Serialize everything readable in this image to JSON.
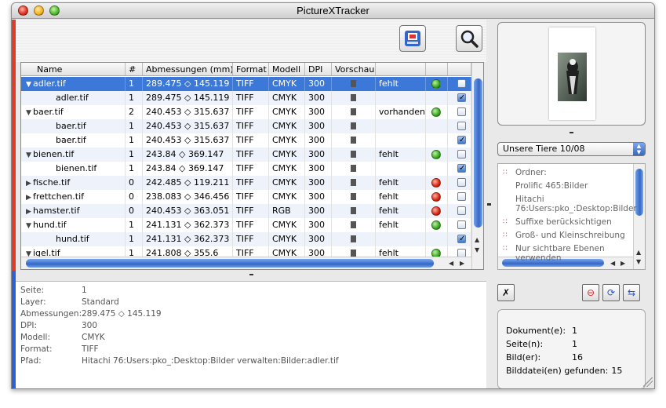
{
  "window": {
    "title": "PictureXTracker"
  },
  "accent": "#3b78d8",
  "table": {
    "headers": [
      "Name",
      "#",
      "Abmessungen (mm)",
      "Format",
      "Modell",
      "DPI",
      "Vorschau",
      "",
      "",
      ""
    ],
    "rows": [
      {
        "name": "adler.tif",
        "indent": 0,
        "tri": "▼",
        "count": "1",
        "dims": "289.475 ◇ 145.119",
        "format": "TIFF",
        "model": "CMYK",
        "dpi": "300",
        "status": "fehlt",
        "dot": "green",
        "check": false,
        "selected": true
      },
      {
        "name": "adler.tif",
        "indent": 1,
        "tri": "",
        "count": "1",
        "dims": "289.475 ◇ 145.119",
        "format": "TIFF",
        "model": "CMYK",
        "dpi": "300",
        "status": "",
        "dot": "",
        "check": true
      },
      {
        "name": "baer.tif",
        "indent": 0,
        "tri": "▼",
        "count": "2",
        "dims": "240.453 ◇ 315.637",
        "format": "TIFF",
        "model": "CMYK",
        "dpi": "300",
        "status": "vorhanden",
        "dot": "green",
        "check": false
      },
      {
        "name": "baer.tif",
        "indent": 1,
        "tri": "",
        "count": "1",
        "dims": "240.453 ◇ 315.637",
        "format": "TIFF",
        "model": "CMYK",
        "dpi": "300",
        "status": "",
        "dot": "",
        "check": false
      },
      {
        "name": "baer.tif",
        "indent": 1,
        "tri": "",
        "count": "1",
        "dims": "240.453 ◇ 315.637",
        "format": "TIFF",
        "model": "CMYK",
        "dpi": "300",
        "status": "",
        "dot": "",
        "check": true
      },
      {
        "name": "bienen.tif",
        "indent": 0,
        "tri": "▼",
        "count": "1",
        "dims": "243.84 ◇ 369.147",
        "format": "TIFF",
        "model": "CMYK",
        "dpi": "300",
        "status": "fehlt",
        "dot": "green",
        "check": false
      },
      {
        "name": "bienen.tif",
        "indent": 1,
        "tri": "",
        "count": "1",
        "dims": "243.84 ◇ 369.147",
        "format": "TIFF",
        "model": "CMYK",
        "dpi": "300",
        "status": "",
        "dot": "",
        "check": true
      },
      {
        "name": "fische.tif",
        "indent": 0,
        "tri": "▶",
        "count": "0",
        "dims": "242.485 ◇ 119.211",
        "format": "TIFF",
        "model": "CMYK",
        "dpi": "300",
        "status": "fehlt",
        "dot": "red",
        "check": false
      },
      {
        "name": "frettchen.tif",
        "indent": 0,
        "tri": "▶",
        "count": "0",
        "dims": "238.083 ◇ 346.456",
        "format": "TIFF",
        "model": "CMYK",
        "dpi": "300",
        "status": "fehlt",
        "dot": "red",
        "check": false
      },
      {
        "name": "hamster.tif",
        "indent": 0,
        "tri": "▶",
        "count": "0",
        "dims": "240.453 ◇ 363.051",
        "format": "TIFF",
        "model": "RGB",
        "dpi": "300",
        "status": "fehlt",
        "dot": "red",
        "check": false
      },
      {
        "name": "hund.tif",
        "indent": 0,
        "tri": "▼",
        "count": "1",
        "dims": "241.131 ◇ 362.373",
        "format": "TIFF",
        "model": "CMYK",
        "dpi": "300",
        "status": "fehlt",
        "dot": "green",
        "check": false
      },
      {
        "name": "hund.tif",
        "indent": 1,
        "tri": "",
        "count": "1",
        "dims": "241.131 ◇ 362.373",
        "format": "TIFF",
        "model": "CMYK",
        "dpi": "300",
        "status": "",
        "dot": "",
        "check": true
      },
      {
        "name": "igel.tif",
        "indent": 0,
        "tri": "▼",
        "count": "1",
        "dims": "241.808 ◇ 355.6",
        "format": "TIFF",
        "model": "CMYK",
        "dpi": "300",
        "status": "fehlt",
        "dot": "green",
        "check": false
      }
    ]
  },
  "info": {
    "labels": [
      "Seite:",
      "Layer:",
      "Abmessungen:",
      "DPI:",
      "Modell:",
      "Format:",
      "Pfad:"
    ],
    "values": [
      "1",
      "Standard",
      "289.475 ◇ 145.119",
      "300",
      "CMYK",
      "TIFF",
      "Hitachi 76:Users:pko_:Desktop:Bilder verwalten:Bilder:adler.tif"
    ]
  },
  "side": {
    "select_value": "Unsere Tiere 10/08",
    "list": [
      {
        "bullet": true,
        "text": "Ordner:"
      },
      {
        "bullet": false,
        "text": "Prolific 465:Bilder"
      },
      {
        "bullet": false,
        "text": "Hitachi 76:Users:pko_:Desktop:Bilder"
      },
      {
        "bullet": true,
        "text": "Suffixe berücksichtigen"
      },
      {
        "bullet": true,
        "text": "Groß- und Kleinschreibung"
      },
      {
        "bullet": true,
        "text": "Nur sichtbare Ebenen verwenden"
      }
    ],
    "stats": [
      {
        "label": "Dokument(e):",
        "value": "1"
      },
      {
        "label": "Seite(n):",
        "value": "1"
      },
      {
        "label": "Bild(er):",
        "value": "16"
      },
      {
        "label": "Bilddatei(en) gefunden:",
        "value": "15"
      }
    ]
  }
}
